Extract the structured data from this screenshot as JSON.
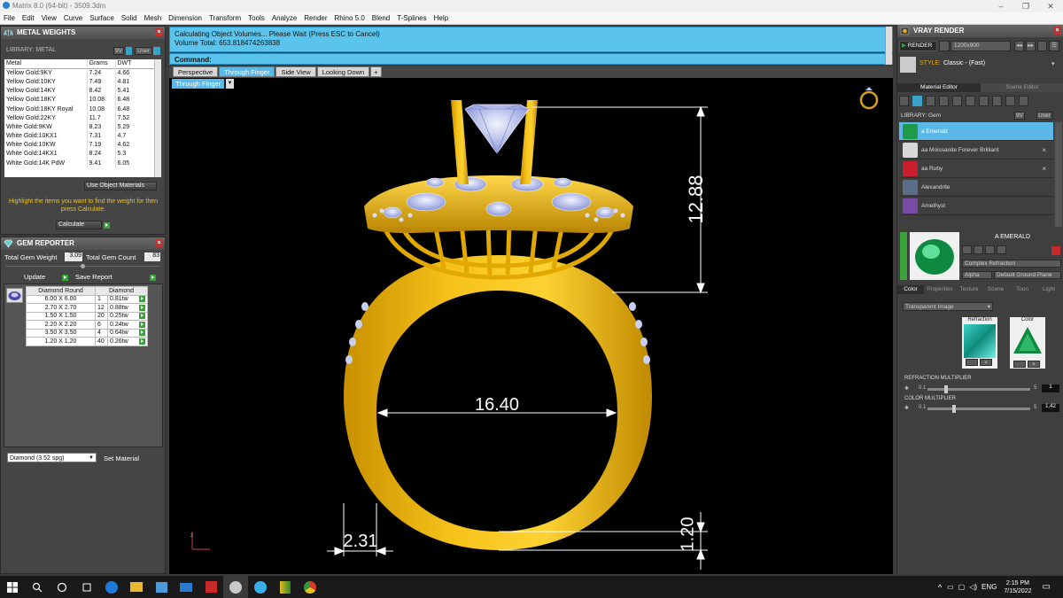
{
  "window": {
    "title": "Matrix 8.0 (64-bit) - 3509.3dm",
    "controls": [
      "–",
      "❐",
      "✕"
    ]
  },
  "menu": [
    "File",
    "Edit",
    "View",
    "Curve",
    "Surface",
    "Solid",
    "Mesh",
    "Dimension",
    "Transform",
    "Tools",
    "Analyze",
    "Render",
    "Rhino 5.0",
    "Blend",
    "T-Splines",
    "Help"
  ],
  "metal_weights": {
    "title": "METAL WEIGHTS",
    "library_label": "LIBRARY: METAL",
    "lib_buttons": [
      "9V",
      "User"
    ],
    "columns": [
      "Metal",
      "Grams",
      "DWT"
    ],
    "rows": [
      [
        "Yellow Gold:9KY",
        "7.24",
        "4.66"
      ],
      [
        "Yellow Gold:10KY",
        "7.49",
        "4.81"
      ],
      [
        "Yellow Gold:14KY",
        "8.42",
        "5.41"
      ],
      [
        "Yellow Gold:18KY",
        "10.08",
        "6.48"
      ],
      [
        "Yellow Gold:18KY Royal",
        "10.08",
        "6.48"
      ],
      [
        "Yellow Gold:22KY",
        "11.7",
        "7.52"
      ],
      [
        "White Gold:9KW",
        "8.23",
        "5.29"
      ],
      [
        "White Gold:10KX1",
        "7.31",
        "4.7"
      ],
      [
        "White Gold:10KW",
        "7.19",
        "4.62"
      ],
      [
        "White Gold:14KX1",
        "8.24",
        "5.3"
      ],
      [
        "White Gold:14K PdW",
        "9.41",
        "6.05"
      ]
    ],
    "use_object_materials": "Use Object Materials",
    "hint": "Highlight the items you want to find the weight for then press Calculate.",
    "calculate": "Calculate"
  },
  "gem_reporter": {
    "title": "GEM REPORTER",
    "total_gem_weight_label": "Total Gem Weight",
    "total_gem_weight": "3.09",
    "total_gem_count_label": "Total Gem Count",
    "total_gem_count": "83",
    "update": "Update",
    "save_report": "Save Report",
    "columns": [
      "Diamond Round",
      "Diamond"
    ],
    "rows": [
      [
        "6.00 X 6.00",
        "1",
        "0.81tw"
      ],
      [
        "2.70 X 2.70",
        "12",
        "0.88tw"
      ],
      [
        "1.50 X 1.50",
        "20",
        "0.25tw"
      ],
      [
        "2.20 X 2.20",
        "6",
        "0.24tw"
      ],
      [
        "3.50 X 3.50",
        "4",
        "0.64tw"
      ],
      [
        "1.20 X 1.20",
        "40",
        "0.26tw"
      ]
    ],
    "material_select": "Diamond     (3.52 spg)",
    "set_material": "Set Material"
  },
  "command": {
    "line1": "Calculating Object Volumes... Please Wait (Press ESC to Cancel)",
    "line2": "Volume Total: 653.818474263838",
    "prompt": "Command:"
  },
  "tabs": [
    "Perspective",
    "Through Finger",
    "Side View",
    "Looking Down",
    "+"
  ],
  "active_tab": "Through Finger",
  "viewport_label": "Through Finger",
  "dimensions": {
    "top_height": "12.88",
    "inner_width": "16.40",
    "band_width": "2.31",
    "band_thickness": "1.20"
  },
  "vray": {
    "title": "VRAY RENDER",
    "render": "RENDER",
    "resolution": "1200x900",
    "style_label": "STYLE:",
    "style": "Classic - (Fast)",
    "tabs": [
      "Material Editor",
      "Scene Editor"
    ],
    "library_label": "LIBRARY: Gem",
    "lib_buttons": [
      "9V",
      "User"
    ],
    "gems": [
      {
        "name": "a Emerald",
        "color": "#1e9a4a",
        "selected": true
      },
      {
        "name": "aa Moissanite Forever Brilliant",
        "color": "#d8d8d8",
        "selected": false
      },
      {
        "name": "aa Ruby",
        "color": "#c81e2e",
        "selected": false
      },
      {
        "name": "Alexandrite",
        "color": "#5a6e8a",
        "selected": false
      },
      {
        "name": "Amethyst",
        "color": "#7a4aa8",
        "selected": false
      }
    ],
    "material_name": "A EMERALD",
    "material_type": "Complex Refraction",
    "alpha_label": "Alpha",
    "ground_plane": "Default Ground Plane",
    "subtabs": [
      "Color",
      "Properties",
      "Texture",
      "Scene",
      "Toon",
      "Light"
    ],
    "transparent_select": "Transparent Image",
    "refraction_label": "Refraction",
    "color_label": "Color",
    "refraction_multiplier_label": "REFRACTION MULTIPLIER",
    "refraction_min": "0.1",
    "refraction_max": "5",
    "refraction_value": "1",
    "color_multiplier_label": "COLOR MULTIPLIER",
    "color_min": "0.1",
    "color_max": "5",
    "color_value": "1.42"
  },
  "taskbar": {
    "lang": "ENG",
    "time": "2:15 PM",
    "date": "7/15/2022"
  }
}
